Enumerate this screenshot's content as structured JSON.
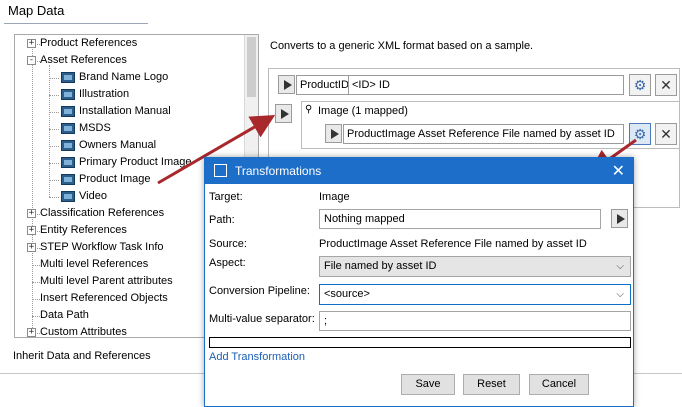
{
  "header": {
    "title": "Map Data"
  },
  "tree": {
    "items": [
      {
        "label": "Product References",
        "expander": "+",
        "level": 0
      },
      {
        "label": "Asset References",
        "expander": "-",
        "level": 0
      },
      {
        "label": "Brand Name Logo",
        "level": 1
      },
      {
        "label": "Illustration",
        "level": 1
      },
      {
        "label": "Installation Manual",
        "level": 1
      },
      {
        "label": "MSDS",
        "level": 1
      },
      {
        "label": "Owners Manual",
        "level": 1
      },
      {
        "label": "Primary Product Image",
        "level": 1
      },
      {
        "label": "Product Image",
        "level": 1
      },
      {
        "label": "Video",
        "level": 1
      },
      {
        "label": "Classification References",
        "expander": "+",
        "level": 0
      },
      {
        "label": "Entity References",
        "expander": "+",
        "level": 0
      },
      {
        "label": "STEP Workflow Task Info",
        "expander": "+",
        "level": 0
      },
      {
        "label": "Multi level References",
        "level": 0
      },
      {
        "label": "Multi level Parent attributes",
        "level": 0
      },
      {
        "label": "Insert Referenced Objects",
        "level": 0
      },
      {
        "label": "Data Path",
        "level": 0
      },
      {
        "label": "Custom Attributes",
        "expander": "+",
        "level": 0
      }
    ]
  },
  "inherit_label": "Inherit Data and References",
  "mapping": {
    "description": "Converts to a generic XML format based on a sample.",
    "row1": {
      "label": "ProductID",
      "value": "<ID> ID"
    },
    "node": {
      "label": "Image (1 mapped)"
    },
    "row2": {
      "value": "ProductImage Asset Reference File named by asset ID"
    }
  },
  "dialog": {
    "title": "Transformations",
    "target_label": "Target:",
    "target_value": "Image",
    "path_label": "Path:",
    "path_value": "Nothing mapped",
    "source_label": "Source:",
    "source_value": "ProductImage Asset Reference File named by asset ID",
    "aspect_label": "Aspect:",
    "aspect_value": "File named by asset ID",
    "pipeline_label": "Conversion Pipeline:",
    "pipeline_value": "<source>",
    "separator_label": "Multi-value separator:",
    "separator_value": ";",
    "add_link": "Add Transformation",
    "save": "Save",
    "reset": "Reset",
    "cancel": "Cancel"
  },
  "colors": {
    "accent": "#1c6ec9",
    "arrow": "#a8282c",
    "link": "#1a5fb4"
  }
}
